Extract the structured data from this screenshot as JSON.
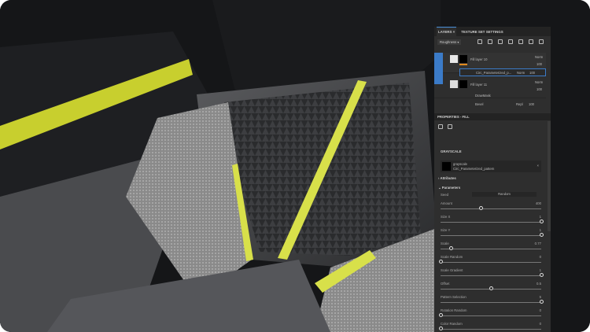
{
  "layers_panel": {
    "tabs": [
      {
        "label": "LAYERS",
        "close": "×"
      },
      {
        "label": "TEXTURE SET SETTINGS"
      }
    ],
    "channel_dropdown": "Roughness",
    "toolbar_icons": [
      "paint-icon",
      "fill-icon",
      "brush-icon",
      "mask-icon",
      "effect-icon",
      "folder-icon",
      "trash-icon"
    ],
    "layers": [
      {
        "name": "Fill layer 10",
        "blend": "Norm",
        "opacity": "100",
        "selected": true
      },
      {
        "name": "Circ_Parameterized_p...",
        "blend": "Norm",
        "opacity": "100",
        "type": "fill-effect"
      },
      {
        "name": "Fill layer 11",
        "blend": "Norm",
        "opacity": "100"
      },
      {
        "name": "DrawMask",
        "type": "anchor"
      },
      {
        "name": "Bevel",
        "blend": "Repl",
        "opacity": "100"
      }
    ]
  },
  "properties_panel": {
    "title": "PROPERTIES - FILL",
    "section": "GRAYSCALE",
    "resource": {
      "name": "grayscale",
      "file": "Circ_Parameterized_pattern"
    },
    "attributes_label": "Attributes",
    "parameters_label": "Parameters",
    "seed": {
      "label": "Seed",
      "button": "Random"
    },
    "sliders": [
      {
        "label": "Amount",
        "value": "400",
        "fraction": 0.4
      },
      {
        "label": "Size X",
        "value": "1",
        "fraction": 1
      },
      {
        "label": "Size Y",
        "value": "1",
        "fraction": 1
      },
      {
        "label": "Scale",
        "value": "0.77",
        "fraction": 0.1
      },
      {
        "label": "Scale Random",
        "value": "0",
        "fraction": 0
      },
      {
        "label": "Scale Gradient",
        "value": "1",
        "fraction": 1
      },
      {
        "label": "Offset",
        "value": "0.5",
        "fraction": 0.5
      },
      {
        "label": "Pattern Selection",
        "value": "5",
        "fraction": 1
      },
      {
        "label": "Rotation Random",
        "value": "0",
        "fraction": 0
      },
      {
        "label": "Color Random",
        "value": "0",
        "fraction": 0
      }
    ]
  },
  "colors": {
    "accent_yellow": "#d8e04a",
    "selection_blue": "#3b7bc8",
    "panel": "#2e2e2e"
  }
}
